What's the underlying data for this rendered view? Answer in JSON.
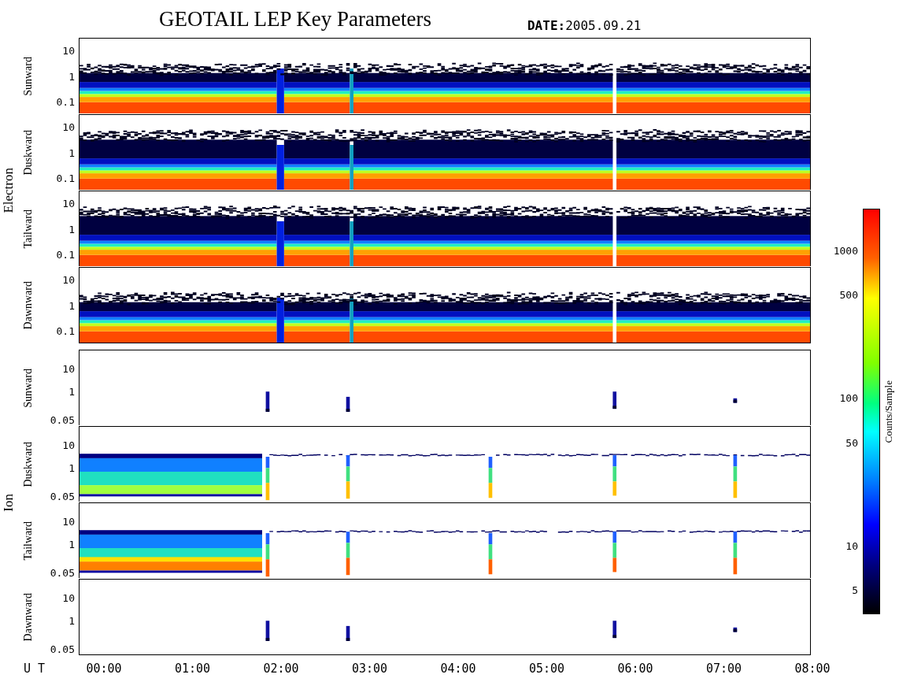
{
  "title": "GEOTAIL LEP Key Parameters",
  "date": "**DATE:**2005.09.21",
  "groups": [
    {
      "species": "Electron",
      "kind": "electron",
      "panels": [
        {
          "direction": "Sunward",
          "kind": "sparse-top",
          "y_ticks": [
            "10",
            "1",
            "0.1"
          ]
        },
        {
          "direction": "Duskward",
          "kind": "dense-top",
          "y_ticks": [
            "10",
            "1",
            "0.1"
          ]
        },
        {
          "direction": "Tailward",
          "kind": "dense-top",
          "y_ticks": [
            "10",
            "1",
            "0.1"
          ]
        },
        {
          "direction": "Dawnward",
          "kind": "sparse-top",
          "y_ticks": [
            "10",
            "1",
            "0.1"
          ]
        }
      ]
    },
    {
      "species": "Ion",
      "kind": "ion",
      "panels": [
        {
          "direction": "Sunward",
          "kind": "spikes",
          "y_ticks": [
            "10",
            "1",
            "0.05"
          ]
        },
        {
          "direction": "Duskward",
          "kind": "early-band",
          "y_ticks": [
            "10",
            "1",
            "0.05"
          ]
        },
        {
          "direction": "Tailward",
          "kind": "early-band-hot",
          "y_ticks": [
            "10",
            "1",
            "0.05"
          ]
        },
        {
          "direction": "Dawnward",
          "kind": "spikes",
          "y_ticks": [
            "10",
            "1",
            "0.05"
          ]
        }
      ]
    }
  ],
  "x_axis": {
    "label": "U T",
    "ticks": [
      "00:00",
      "01:00",
      "02:00",
      "03:00",
      "04:00",
      "05:00",
      "06:00",
      "07:00",
      "08:00"
    ]
  },
  "color_scale": {
    "title": "Counts/Sample",
    "ticks": [
      "1000",
      "500",
      "100",
      "50",
      "10",
      "5"
    ]
  }
}
